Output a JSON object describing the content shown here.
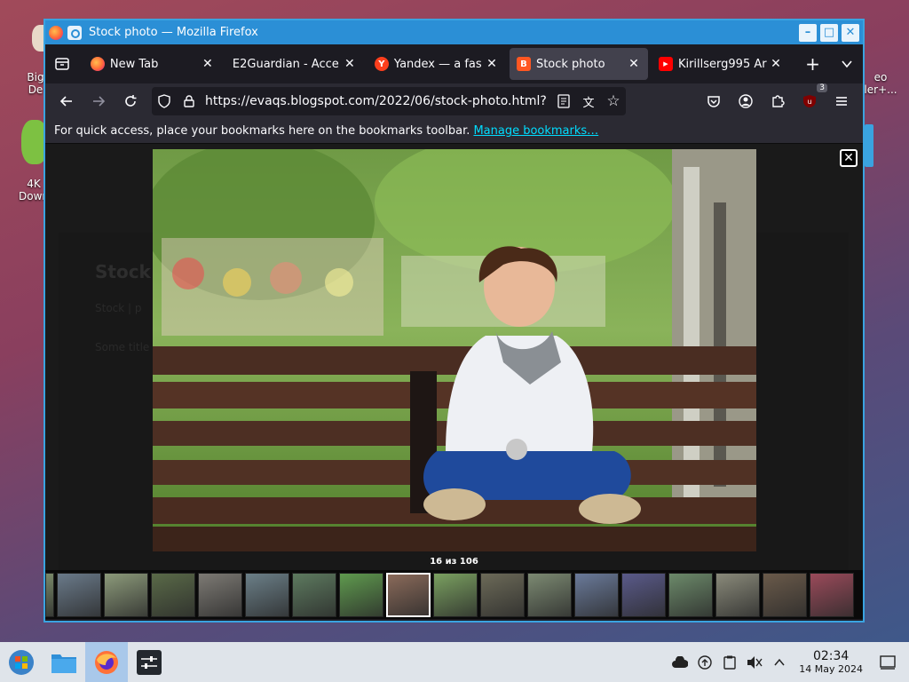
{
  "desktop": {
    "icons": [
      {
        "label": "Big\nDe"
      },
      {
        "label": "4K\nDown"
      },
      {
        "label": "eo\nler+..."
      }
    ]
  },
  "window": {
    "title": "Stock photo — Mozilla Firefox",
    "controls": {
      "minimize": "–",
      "maximize": "□",
      "close": "✕"
    }
  },
  "tabs": [
    {
      "label": "New Tab",
      "favicon_color": "#ff7139",
      "favicon_text": "",
      "active": false
    },
    {
      "label": "E2Guardian - Acce",
      "favicon_color": "",
      "favicon_text": "",
      "active": false
    },
    {
      "label": "Yandex — a fas",
      "favicon_color": "#fc3f1d",
      "favicon_text": "Y",
      "active": false
    },
    {
      "label": "Stock photo",
      "favicon_color": "#ff5722",
      "favicon_text": "B",
      "active": true
    },
    {
      "label": "Kirillserg995 Ar",
      "favicon_color": "#ff0000",
      "favicon_text": "▶",
      "active": false
    }
  ],
  "tab_close": "✕",
  "newtab": "+",
  "navbar": {
    "url": "https://evaqs.blogspot.com/2022/06/stock-photo.html?",
    "ublock_badge": "3"
  },
  "bookmarks_bar": {
    "message": "For quick access, place your bookmarks here on the bookmarks toolbar.",
    "manage_link": "Manage bookmarks…"
  },
  "page": {
    "title": "Stock",
    "dim_line_1": "Stock | p",
    "dim_line_2": "Some title"
  },
  "lightbox": {
    "close": "✕",
    "counter": "16 из 106",
    "selected_index": 8,
    "thumbnail_colors": [
      "#7a8a6a",
      "#6a7a8a",
      "#8c9a7a",
      "#5a6a48",
      "#7d7a74",
      "#6b7f88",
      "#5d7a5f",
      "#5f9a4e",
      "#8a6a5a",
      "#7aa060",
      "#6c6a58",
      "#7c8a72",
      "#6a7a9a",
      "#5a5a8a",
      "#6c8a6a",
      "#8a8a7a",
      "#6a5a4a",
      "#9a4a5a"
    ]
  },
  "taskbar": {
    "time": "02:34",
    "date": "14 May 2024"
  },
  "colors": {
    "accent": "#2b8fd6",
    "link": "#00ddff"
  }
}
